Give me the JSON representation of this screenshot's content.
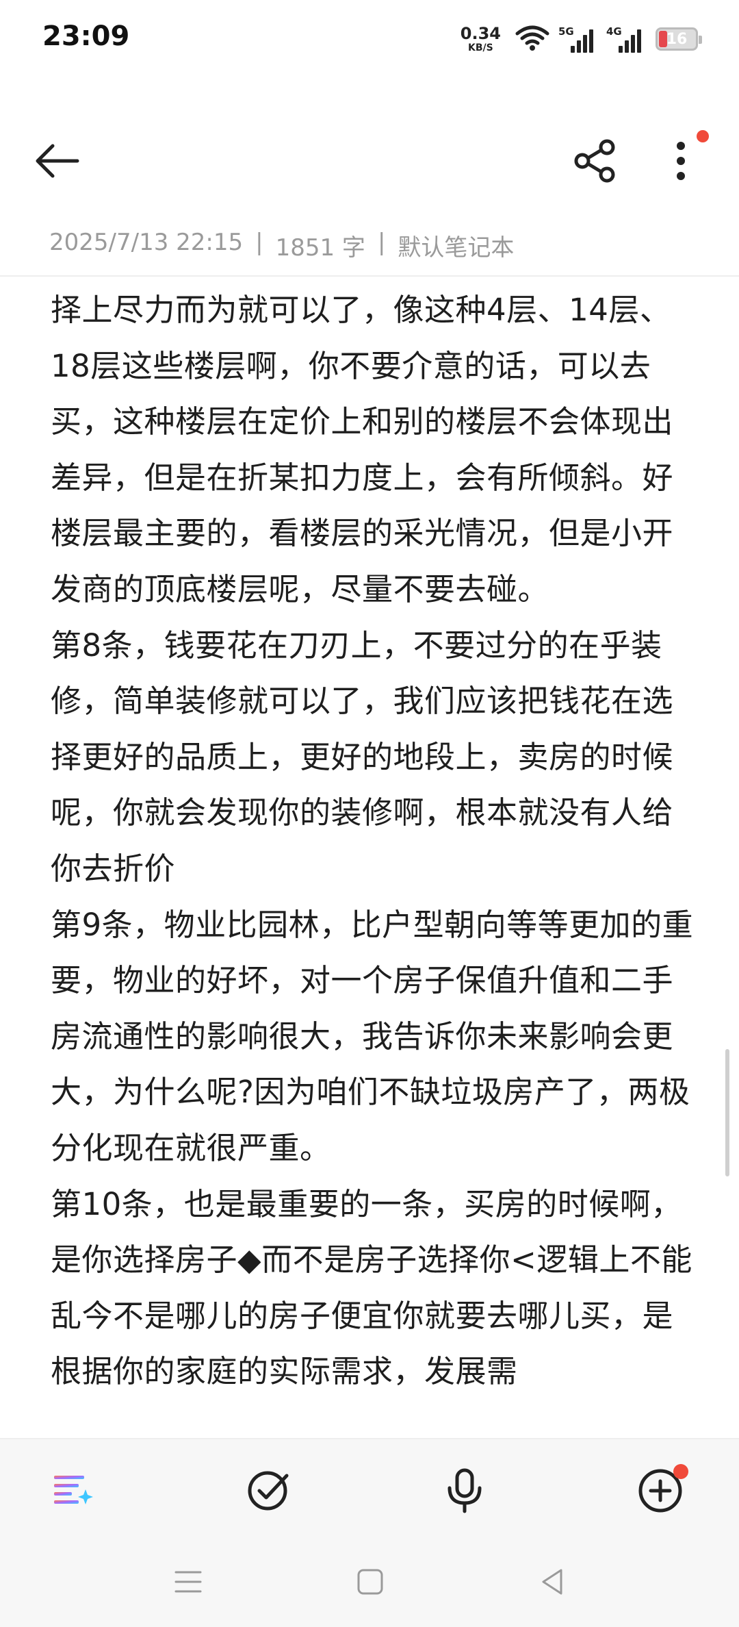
{
  "status_bar": {
    "time": "23:09",
    "net_speed_value": "0.34",
    "net_speed_unit": "KB/S",
    "signal_1_label": "5G",
    "signal_2_label": "4G",
    "battery_level": "16"
  },
  "header": {
    "back_icon": "arrow-left-icon",
    "share_icon": "share-icon",
    "more_icon": "more-vertical-icon"
  },
  "meta": {
    "datetime": "2025/7/13 22:15",
    "separator": "|",
    "word_count": "1851 字",
    "notebook": "默认笔记本"
  },
  "note": {
    "paragraphs": [
      "择上尽力而为就可以了，像这种4层、14层、18层这些楼层啊，你不要介意的话，可以去买，这种楼层在定价上和别的楼层不会体现出差异，但是在折某扣力度上，会有所倾斜。好楼层最主要的，看楼层的采光情况，但是小开发商的顶底楼层呢，尽量不要去碰。",
      "第8条，钱要花在刀刃上，不要过分的在乎装修，简单装修就可以了，我们应该把钱花在选择更好的品质上，更好的地段上，卖房的时候呢，你就会发现你的装修啊，根本就没有人给你去折价",
      "第9条，物业比园林，比户型朝向等等更加的重要，物业的好坏，对一个房子保值升值和二手房流通性的影响很大，我告诉你未来影响会更大，为什么呢?因为咱们不缺垃圾房产了，两极分化现在就很严重。",
      "第10条，也是最重要的一条，买房的时候啊，是你选择房子◆而不是房子选择你<逻辑上不能乱今不是哪儿的房子便宜你就要去哪儿买，是根据你的家庭的实际需求，发展需"
    ]
  },
  "toolbar": {
    "ai_format_icon": "ai-format-icon",
    "checklist_icon": "check-circle-icon",
    "voice_icon": "microphone-icon",
    "add_icon": "plus-circle-icon"
  },
  "navbar": {
    "menu_icon": "menu-icon",
    "home_icon": "home-square-icon",
    "back_icon": "back-triangle-icon"
  },
  "colors": {
    "accent_red": "#f04a3a",
    "meta_gray": "#9a9a9a",
    "text": "#1e1e1e"
  }
}
